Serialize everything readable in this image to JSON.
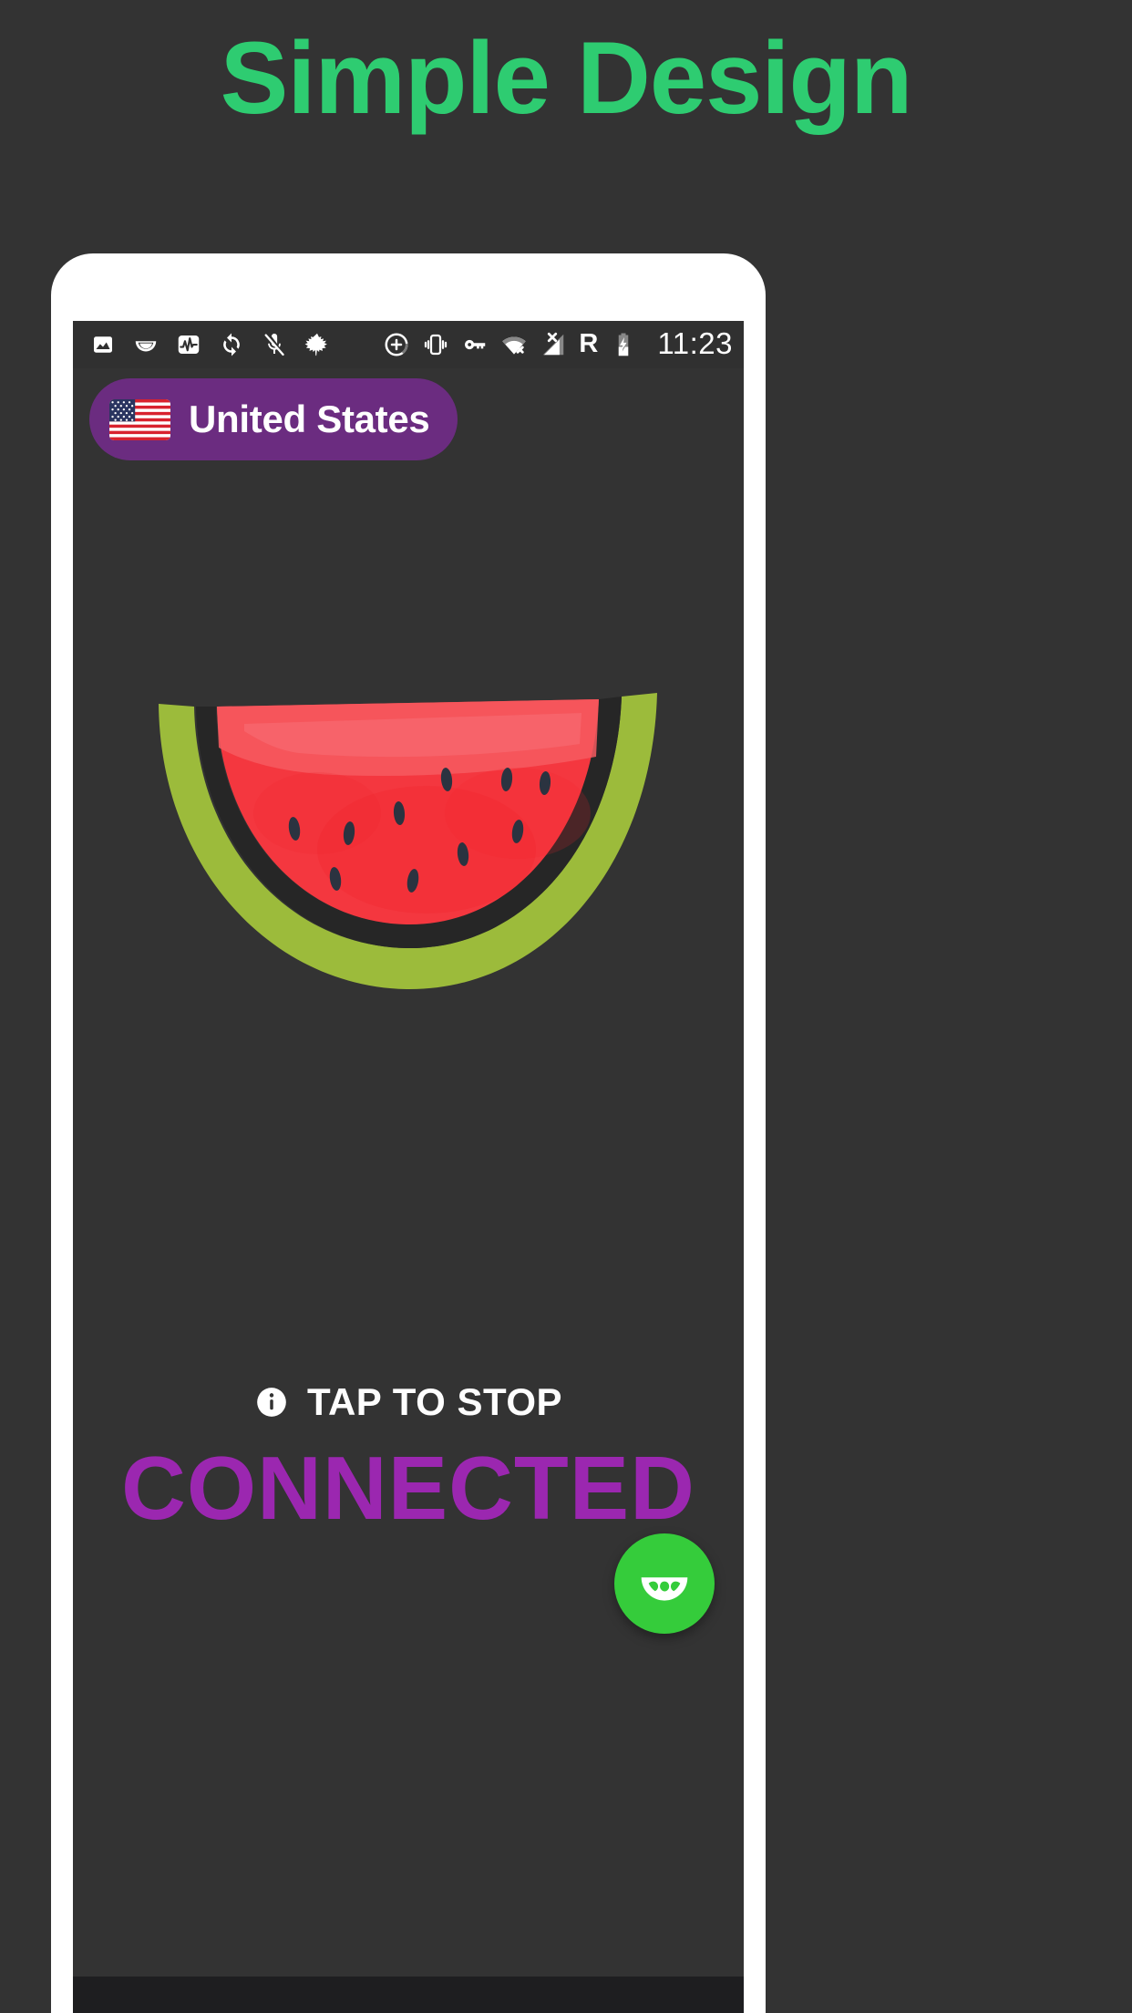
{
  "promo": {
    "headline": "Simple Design",
    "headline_color": "#2ECC71",
    "background_color": "#333333"
  },
  "phone": {
    "bezel_color": "#FFFFFF",
    "screen_background": "#333333"
  },
  "status_bar": {
    "background_color": "#303030",
    "clock": "11:23",
    "roaming_label": "R",
    "left_icons": [
      {
        "name": "image-icon",
        "label": "Screenshot"
      },
      {
        "name": "melon-slice-icon",
        "label": "VPN app notification"
      },
      {
        "name": "pulse-graph-icon",
        "label": "Monitor"
      },
      {
        "name": "sync-icon",
        "label": "Sync"
      },
      {
        "name": "microphone-muted-icon",
        "label": "Microphone muted"
      },
      {
        "name": "maple-leaf-icon",
        "label": "Leaf"
      }
    ],
    "right_icons": [
      {
        "name": "add-circle-icon",
        "label": "Add"
      },
      {
        "name": "vibrate-icon",
        "label": "Vibrate"
      },
      {
        "name": "vpn-key-icon",
        "label": "VPN key"
      },
      {
        "name": "wifi-off-icon",
        "label": "Wi-Fi disconnected"
      },
      {
        "name": "signal-off-icon",
        "label": "No signal"
      },
      {
        "name": "roaming-icon",
        "label": "R"
      },
      {
        "name": "battery-charging-icon",
        "label": "Battery charging"
      }
    ]
  },
  "app": {
    "country": {
      "name": "United States",
      "flag": "us-flag-icon",
      "pill_color": "#6B2C80"
    },
    "hero_icon": "watermelon-slice-illustration",
    "hero_colors": {
      "flesh": "#F4373F",
      "flesh_light": "#F6555B",
      "seed": "#2B3340",
      "rind_dark": "#272727",
      "rind_green": "#9CBB3B"
    },
    "action": {
      "info_icon": "info-icon",
      "tap_label": "TAP TO STOP"
    },
    "connection_status": {
      "label": "CONNECTED",
      "color": "#9B27B0"
    },
    "fab": {
      "icon": "melon-slice-icon",
      "color": "#35CC3B"
    },
    "navigation_bar_color": "#1E1E20"
  }
}
